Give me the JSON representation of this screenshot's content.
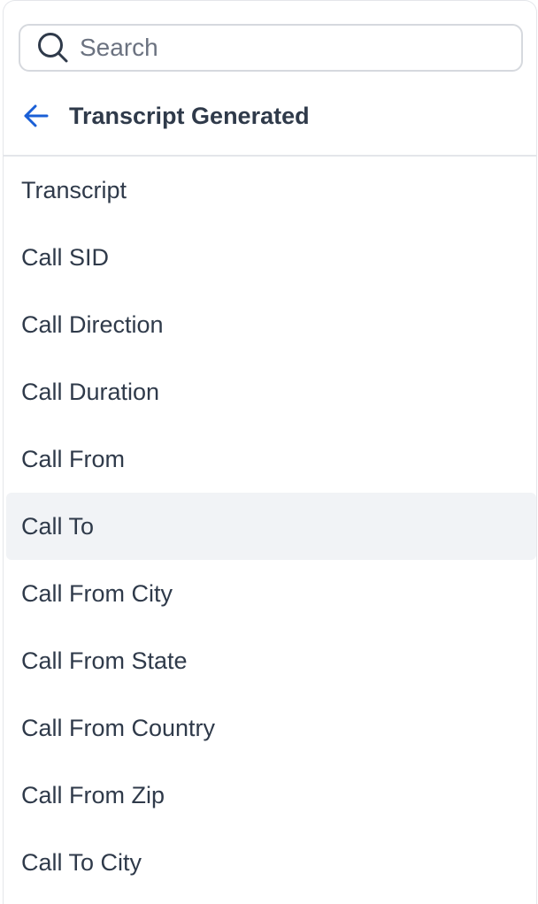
{
  "search": {
    "placeholder": "Search",
    "value": ""
  },
  "header": {
    "title": "Transcript Generated"
  },
  "items": [
    {
      "label": "Transcript"
    },
    {
      "label": "Call SID"
    },
    {
      "label": "Call Direction"
    },
    {
      "label": "Call Duration"
    },
    {
      "label": "Call From"
    },
    {
      "label": "Call To",
      "hovered": true
    },
    {
      "label": "Call From City"
    },
    {
      "label": "Call From State"
    },
    {
      "label": "Call From Country"
    },
    {
      "label": "Call From Zip"
    },
    {
      "label": "Call To City"
    }
  ],
  "colors": {
    "accent": "#1a5fd6",
    "text": "#2f3a4a",
    "hover_bg": "#f1f3f6",
    "border": "#d6d9de"
  },
  "icons": {
    "search": "search-icon",
    "back": "arrow-left-icon"
  }
}
